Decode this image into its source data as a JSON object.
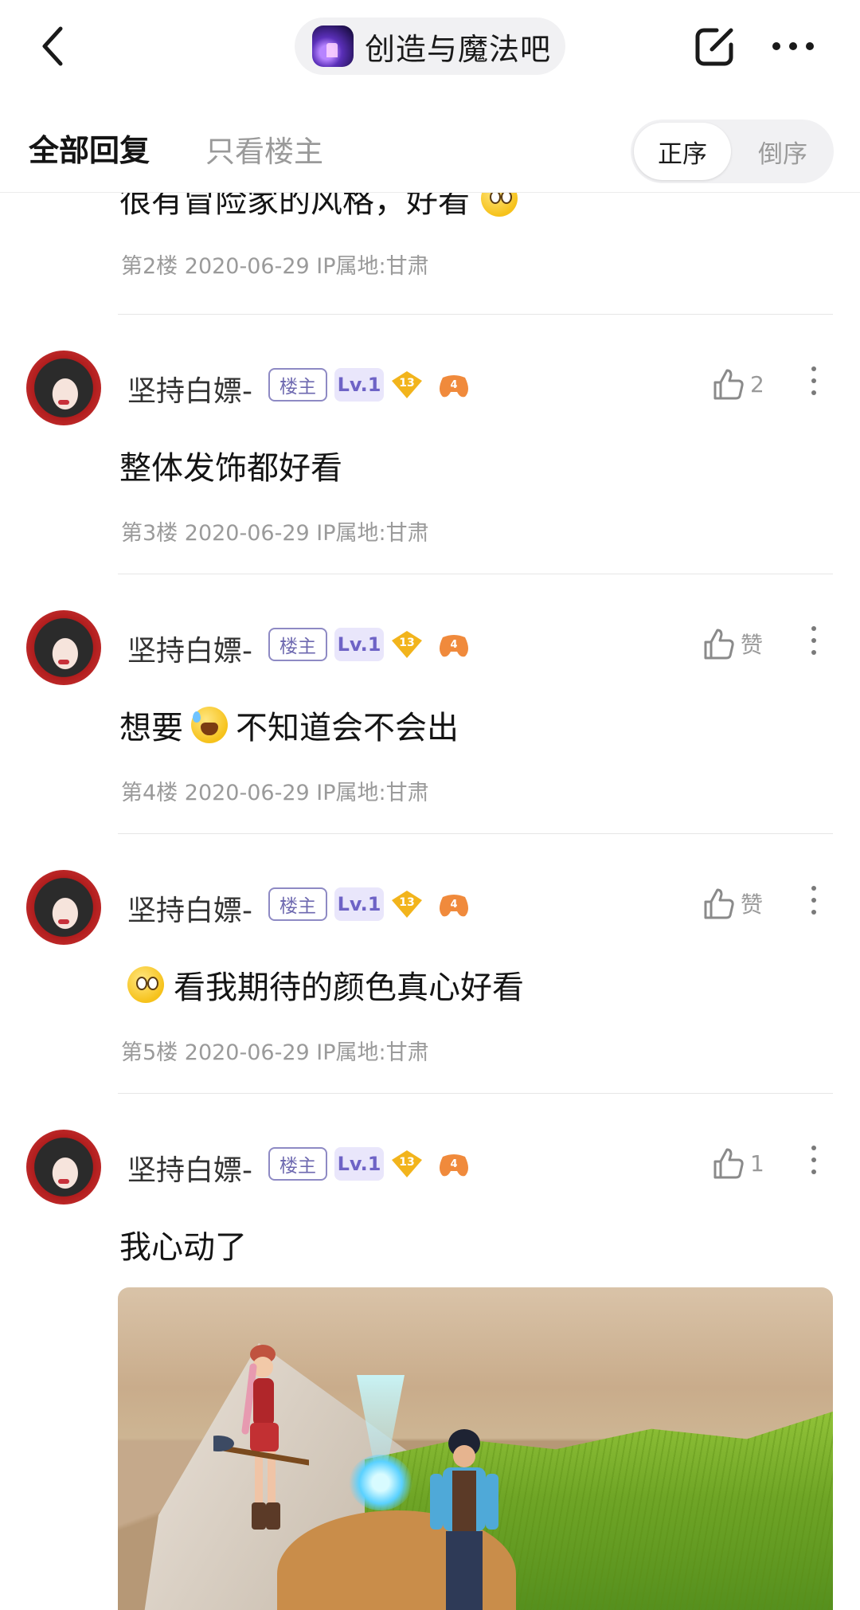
{
  "nav": {
    "forum_name": "创造与魔法吧",
    "forum_logo_icon": "forum-logo-icon",
    "back_icon": "chevron-left-icon",
    "share_icon": "share-icon",
    "more_icon": "more-horizontal-icon"
  },
  "filter": {
    "tab_all": "全部回复",
    "tab_op_only": "只看楼主",
    "sort_asc": "正序",
    "sort_desc": "倒序",
    "active_sort": "正序"
  },
  "partial_post": {
    "text": "很有冒险家的风格，好看",
    "meta": "第2楼  2020-06-29  IP属地:甘肃"
  },
  "posts": [
    {
      "username": "坚持白嫖-",
      "badge_op": "楼主",
      "badge_level": "Lv.1",
      "badge_diamond": "13",
      "badge_game": "4",
      "like_label": "2",
      "text_before": "整体发饰都好看",
      "text_after": "",
      "meta": "第3楼  2020-06-29  IP属地:甘肃"
    },
    {
      "username": "坚持白嫖-",
      "badge_op": "楼主",
      "badge_level": "Lv.1",
      "badge_diamond": "13",
      "badge_game": "4",
      "like_label": "赞",
      "text_before": "想要",
      "text_after": "不知道会不会出",
      "meta": "第4楼  2020-06-29  IP属地:甘肃"
    },
    {
      "username": "坚持白嫖-",
      "badge_op": "楼主",
      "badge_level": "Lv.1",
      "badge_diamond": "13",
      "badge_game": "4",
      "like_label": "赞",
      "text_before": "",
      "text_after": "看我期待的颜色真心好看",
      "meta": "第5楼  2020-06-29  IP属地:甘肃"
    },
    {
      "username": "坚持白嫖-",
      "badge_op": "楼主",
      "badge_level": "Lv.1",
      "badge_diamond": "13",
      "badge_game": "4",
      "like_label": "1",
      "text_before": "我心动了",
      "text_after": "",
      "meta": ""
    }
  ],
  "colors": {
    "accent_purple": "#6e63c6",
    "op_badge_border": "#8e8ac4",
    "meta_gray": "#9a9a9a",
    "diamond_gold": "#f2b41c",
    "game_badge_orange": "#f08a3c"
  }
}
